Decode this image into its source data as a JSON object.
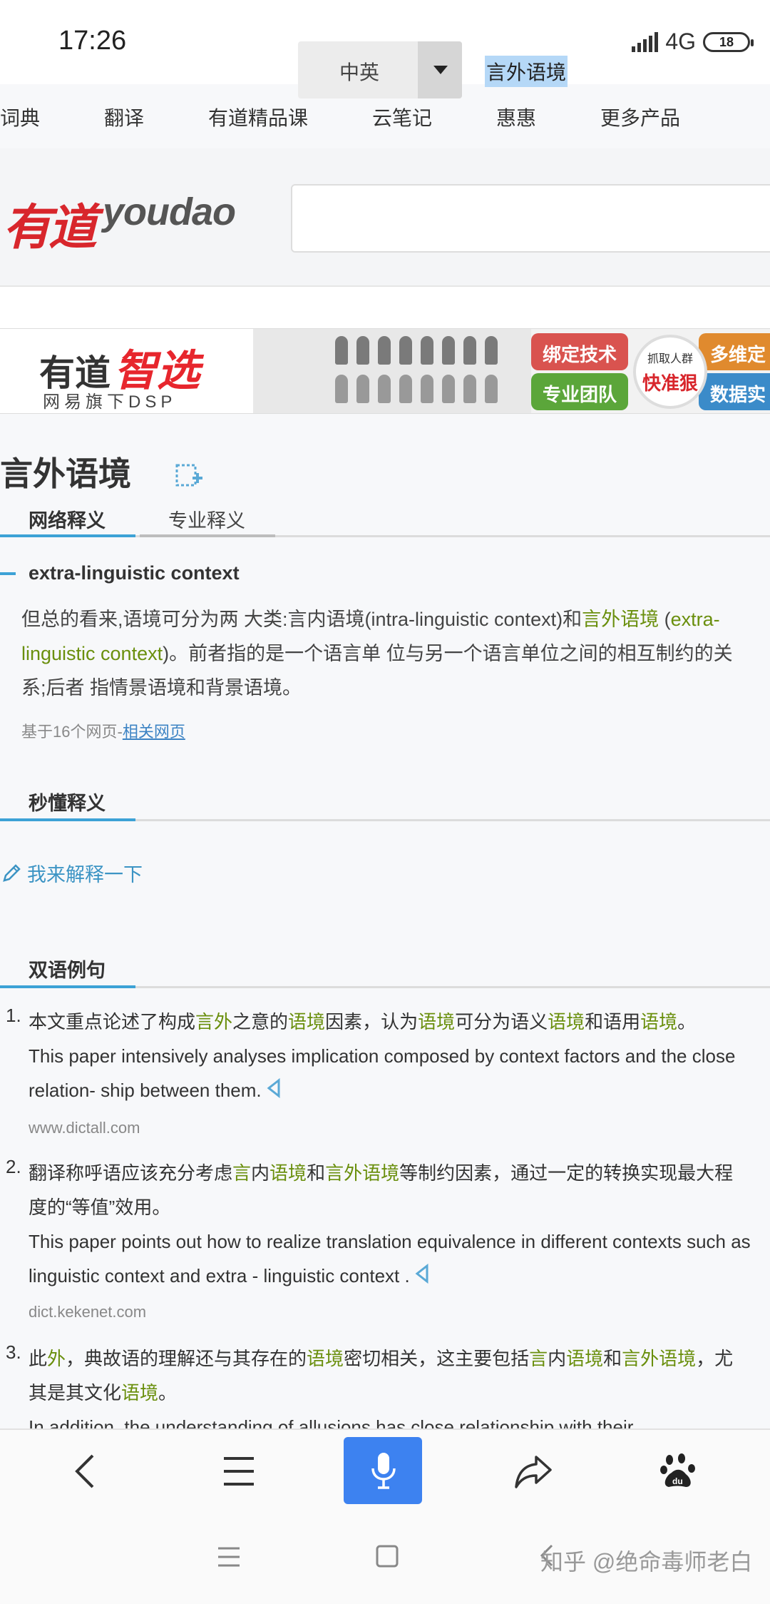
{
  "status": {
    "time": "17:26",
    "network": "4G",
    "battery": "18"
  },
  "top_nav": [
    "词典",
    "翻译",
    "有道精品课",
    "云笔记",
    "惠惠",
    "更多产品"
  ],
  "logo": {
    "cn": "有道",
    "en": "youdao"
  },
  "search": {
    "lang": "中英",
    "query": "言外语境"
  },
  "banner": {
    "brand_a": "有道",
    "brand_b": "智选",
    "brand_c": "网易旗下DSP",
    "tags": [
      "绑定技术",
      "专业团队",
      "多维定",
      "数据实"
    ],
    "circle_a": "抓取人群",
    "circle_b": "快准狠"
  },
  "word": {
    "title": "言外语境",
    "tabs": [
      "网络释义",
      "专业释义"
    ]
  },
  "definition": {
    "head": "extra-linguistic context",
    "body": [
      {
        "t": "但总的看来,语境可分为两 大类:言内语境(intra-linguistic context)和",
        "h": false
      },
      {
        "t": "言外语境",
        "h": true
      },
      {
        "t": " (",
        "h": false
      },
      {
        "t": "extra-linguistic context",
        "h": true
      },
      {
        "t": ")。前者指的是一个语言单 位与另一个语言单位之间的相互制约的关系;后者 指情景语境和背景语境。",
        "h": false
      }
    ],
    "source_prefix": "基于16个网页-",
    "source_link": "相关网页"
  },
  "quick": {
    "title": "秒懂释义",
    "explain": "我来解释一下"
  },
  "bilingual": {
    "title": "双语例句",
    "examples": [
      {
        "num": "1.",
        "cn": [
          {
            "t": "本文重点论述了构成",
            "h": false
          },
          {
            "t": "言外",
            "h": true
          },
          {
            "t": "之意的",
            "h": false
          },
          {
            "t": "语境",
            "h": true
          },
          {
            "t": "因素，认为",
            "h": false
          },
          {
            "t": "语境",
            "h": true
          },
          {
            "t": "可分为语义",
            "h": false
          },
          {
            "t": "语境",
            "h": true
          },
          {
            "t": "和语用",
            "h": false
          },
          {
            "t": "语境",
            "h": true
          },
          {
            "t": "。",
            "h": false
          }
        ],
        "en": "This paper intensively analyses implication composed by context factors and the close relation- ship between them.",
        "source": "www.dictall.com"
      },
      {
        "num": "2.",
        "cn": [
          {
            "t": "翻译称呼语应该充分考虑",
            "h": false
          },
          {
            "t": "言",
            "h": true
          },
          {
            "t": "内",
            "h": false
          },
          {
            "t": "语境",
            "h": true
          },
          {
            "t": "和",
            "h": false
          },
          {
            "t": "言外语境",
            "h": true
          },
          {
            "t": "等制约因素，通过一定的转换实现最大程度的“等值”效用。",
            "h": false
          }
        ],
        "en": "This paper points out how to realize translation equivalence in different contexts such as linguistic context and extra - linguistic context .",
        "source": "dict.kekenet.com"
      },
      {
        "num": "3.",
        "cn": [
          {
            "t": "此",
            "h": false
          },
          {
            "t": "外",
            "h": true
          },
          {
            "t": "，典故语的理解还与其存在的",
            "h": false
          },
          {
            "t": "语境",
            "h": true
          },
          {
            "t": "密切相关，这主要包括",
            "h": false
          },
          {
            "t": "言",
            "h": true
          },
          {
            "t": "内",
            "h": false
          },
          {
            "t": "语境",
            "h": true
          },
          {
            "t": "和",
            "h": false
          },
          {
            "t": "言外语境",
            "h": true
          },
          {
            "t": "，尤其是其文化",
            "h": false
          },
          {
            "t": "语境",
            "h": true
          },
          {
            "t": "。",
            "h": false
          }
        ],
        "en": "In addition, the understanding of allusions has close relationship with their",
        "source": ""
      }
    ]
  },
  "watermark": "知乎 @绝命毒师老白",
  "colors": {
    "highlight": "#6a8f0d",
    "link": "#3c94c4",
    "accent": "#3da2d6",
    "mic": "#3d82f0",
    "logo_red": "#d8262c"
  },
  "icons": [
    "back-icon",
    "menu-icon",
    "microphone-icon",
    "share-icon",
    "baidu-paw-icon",
    "add-to-wordbook-icon",
    "pencil-icon",
    "speaker-icon",
    "chevron-down-icon"
  ]
}
